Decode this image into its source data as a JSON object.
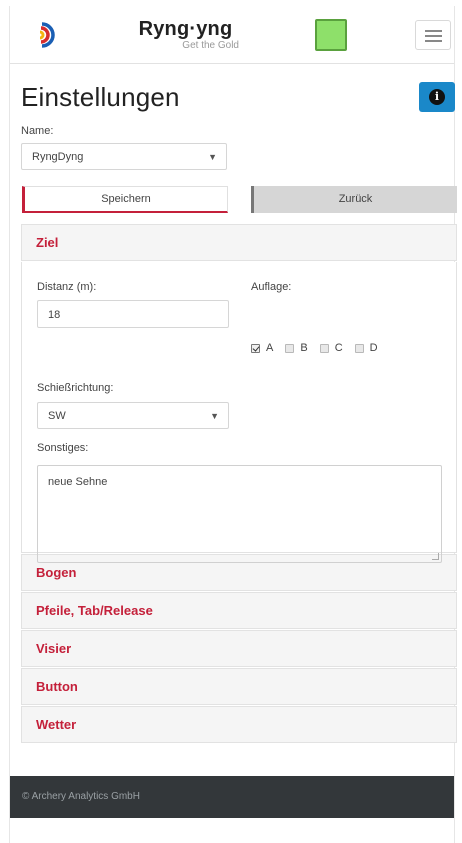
{
  "app": {
    "brand_name": "Ryng·yng",
    "brand_sub": "Get the Gold",
    "status_color": "#8ee06a",
    "accent_color": "#c4203a",
    "info_color": "#1a88c9"
  },
  "header": {
    "title": "Einstellungen",
    "info_icon": "info-icon"
  },
  "name_field": {
    "label": "Name:",
    "value": "RyngDyng"
  },
  "actions": {
    "save_label": "Speichern",
    "back_label": "Zurück"
  },
  "sections": {
    "ziel": {
      "title": "Ziel",
      "distance_label": "Distanz (m):",
      "distance_value": "18",
      "direction_label": "Schießrichtung:",
      "direction_value": "SW",
      "target_face_label": "Auflage:",
      "target_faces": [
        {
          "label": "A",
          "checked": true
        },
        {
          "label": "B",
          "checked": false
        },
        {
          "label": "C",
          "checked": false
        },
        {
          "label": "D",
          "checked": false
        }
      ],
      "notes_label": "Sonstiges:",
      "notes_value": "neue Sehne"
    },
    "collapsed": [
      {
        "title": "Bogen"
      },
      {
        "title": "Pfeile, Tab/Release"
      },
      {
        "title": "Visier"
      },
      {
        "title": "Button"
      },
      {
        "title": "Wetter"
      }
    ]
  },
  "footer": {
    "text": "© Archery Analytics GmbH"
  }
}
